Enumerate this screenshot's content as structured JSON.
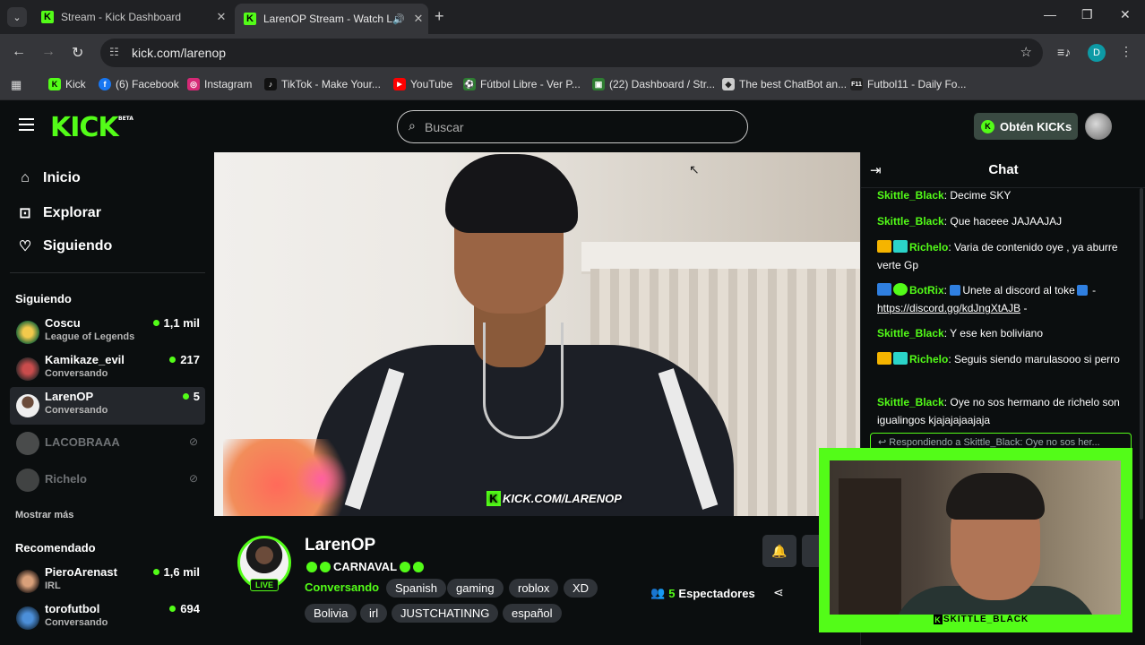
{
  "browser": {
    "tabs": [
      {
        "title": "Stream - Kick Dashboard",
        "active": false
      },
      {
        "title": "LarenOP Stream - Watch Liv",
        "active": true
      }
    ],
    "url": "kick.com/larenop",
    "profile_initial": "D",
    "bookmarks": [
      {
        "label": "Kick",
        "icon": "kick-icon",
        "color": "#53fc18"
      },
      {
        "label": "(6) Facebook",
        "icon": "facebook-icon",
        "color": "#1877f2"
      },
      {
        "label": "Instagram",
        "icon": "instagram-icon",
        "color": "#d62976"
      },
      {
        "label": "TikTok - Make Your...",
        "icon": "tiktok-icon",
        "color": "#111111"
      },
      {
        "label": "YouTube",
        "icon": "youtube-icon",
        "color": "#ff0000"
      },
      {
        "label": "Fútbol Libre - Ver P...",
        "icon": "soccer-icon",
        "color": "#2e7d32"
      },
      {
        "label": "(22) Dashboard / Str...",
        "icon": "dashboard-icon",
        "color": "#2e7d32"
      },
      {
        "label": "The best ChatBot an...",
        "icon": "chatbot-icon",
        "color": "#cccccc"
      },
      {
        "label": "Futbol11 - Daily Fo...",
        "icon": "futbol11-icon",
        "color": "#222222"
      }
    ]
  },
  "header": {
    "logo": "KICK",
    "logo_badge": "BETA",
    "search_placeholder": "Buscar",
    "get_kicks_label": "Obtén KICKs",
    "accent": "#53fc18"
  },
  "sidebar": {
    "nav": [
      {
        "label": "Inicio",
        "icon": "home-icon"
      },
      {
        "label": "Explorar",
        "icon": "explore-icon"
      },
      {
        "label": "Siguiendo",
        "icon": "heart-icon"
      }
    ],
    "following_heading": "Siguiendo",
    "following": [
      {
        "name": "Coscu",
        "category": "League of Legends",
        "viewers": "1,1 mil",
        "live": true
      },
      {
        "name": "Kamikaze_evil",
        "category": "Conversando",
        "viewers": "217",
        "live": true
      },
      {
        "name": "LarenOP",
        "category": "Conversando",
        "viewers": "5",
        "live": true,
        "active": true
      },
      {
        "name": "LACOBRAAA",
        "live": false
      },
      {
        "name": "Richelo",
        "live": false
      }
    ],
    "show_more": "Mostrar más",
    "recommended_heading": "Recomendado",
    "recommended": [
      {
        "name": "PieroArenast",
        "category": "IRL",
        "viewers": "1,6 mil"
      },
      {
        "name": "torofutbol",
        "category": "Conversando",
        "viewers": "694"
      }
    ]
  },
  "video": {
    "watermark": "KICK.COM/LARENOP"
  },
  "stream": {
    "streamer": "LarenOP",
    "live_badge": "LIVE",
    "title": "CARNAVAL",
    "category": "Conversando",
    "tags_row1": [
      "Spanish",
      "gaming",
      "roblox",
      "XD"
    ],
    "tags_row2": [
      "Bolivia",
      "irl",
      "JUSTCHATINNG",
      "español"
    ],
    "viewer_count": "5",
    "viewer_label": "Espectadores"
  },
  "chat": {
    "title": "Chat",
    "messages": [
      {
        "user": "Skittle_Black",
        "text": "Decime SKY"
      },
      {
        "user": "Skittle_Black",
        "text": "Que haceee JAJAAJAJ"
      },
      {
        "user": "Richelo",
        "text": "Varia de contenido oye , ya aburre verte Gp"
      },
      {
        "user": "BotRix",
        "text": "Unete al discord al toke",
        "link": "https://discord.gg/kdJngXtAJB",
        "suffix": "-"
      },
      {
        "user": "Skittle_Black",
        "text": "Y ese ken boliviano"
      },
      {
        "user": "Richelo",
        "text": "Seguis siendo marulasooo si perro"
      },
      {
        "user": "Skittle_Black",
        "text": "Oye no sos hermano de richelo son igualingos kjajajajaajaja"
      }
    ],
    "reply_preview": "Respondiendo a Skittle_Black: Oye no sos her..."
  },
  "cam_overlay": {
    "label": "SKITTLE_BLACK"
  }
}
